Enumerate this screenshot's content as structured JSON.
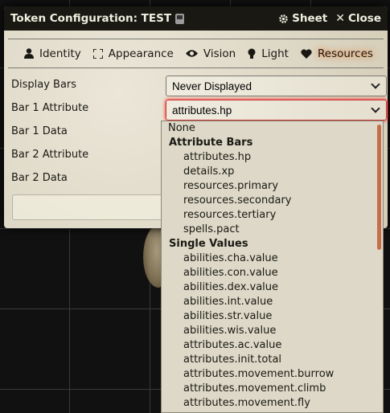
{
  "window": {
    "title": "Token Configuration: TEST",
    "sheet_label": "Sheet",
    "close_label": "Close"
  },
  "tabs": [
    {
      "label": "Identity",
      "icon": "user-icon"
    },
    {
      "label": "Appearance",
      "icon": "expand-icon"
    },
    {
      "label": "Vision",
      "icon": "eye-icon"
    },
    {
      "label": "Light",
      "icon": "lightbulb-icon"
    },
    {
      "label": "Resources",
      "icon": "heart-icon",
      "active": true
    }
  ],
  "form": {
    "display_bars_label": "Display Bars",
    "display_bars_value": "Never Displayed",
    "bar1_attribute_label": "Bar 1 Attribute",
    "bar1_attribute_value": "attributes.hp",
    "bar1_data_label": "Bar 1 Data",
    "bar2_attribute_label": "Bar 2 Attribute",
    "bar2_data_label": "Bar 2 Data"
  },
  "dropdown": {
    "none_option": "None",
    "group1": "Attribute Bars",
    "group1_options": [
      "attributes.hp",
      "details.xp",
      "resources.primary",
      "resources.secondary",
      "resources.tertiary",
      "spells.pact"
    ],
    "group2": "Single Values",
    "group2_options": [
      "abilities.cha.value",
      "abilities.con.value",
      "abilities.dex.value",
      "abilities.int.value",
      "abilities.str.value",
      "abilities.wis.value",
      "attributes.ac.value",
      "attributes.init.total",
      "attributes.movement.burrow",
      "attributes.movement.climb",
      "attributes.movement.fly"
    ]
  },
  "colors": {
    "header_bg": "#191813",
    "active_glow": "#ff6400",
    "scrollbar": "#c76d4a"
  }
}
